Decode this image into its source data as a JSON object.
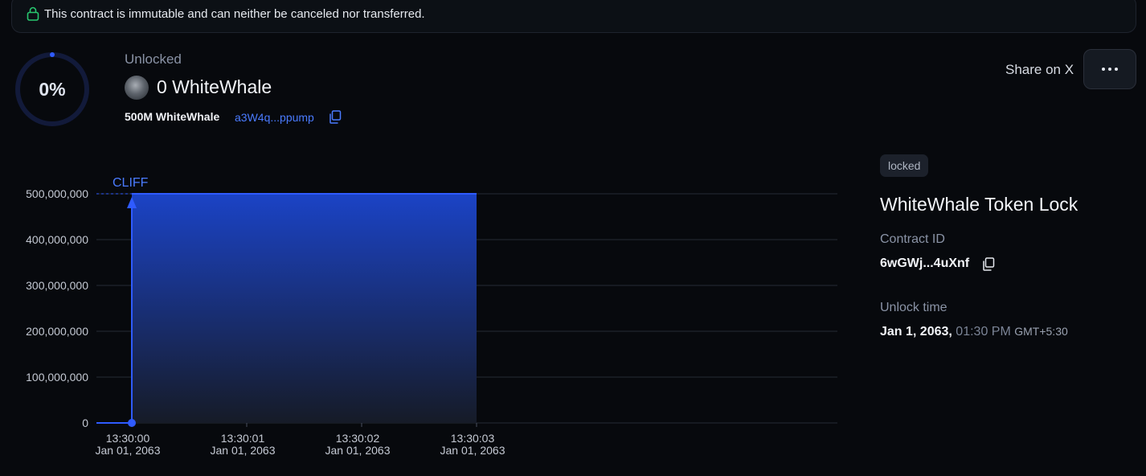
{
  "banner": {
    "icon": "lock-icon",
    "text": "This contract is immutable and can neither be canceled nor transferred."
  },
  "progress": {
    "percent_label": "0%",
    "value": 0
  },
  "header": {
    "status": "Unlocked",
    "amount": "0 WhiteWhale",
    "total": "500M WhiteWhale",
    "address": "a3W4q...ppump",
    "share_label": "Share on X",
    "menu_icon": "more-horizontal-icon"
  },
  "details": {
    "badge": "locked",
    "title": "WhiteWhale Token Lock",
    "contract_id_label": "Contract ID",
    "contract_id": "6wGWj...4uXnf",
    "unlock_time_label": "Unlock time",
    "unlock_date": "Jan 1, 2063,",
    "unlock_time": "01:30 PM",
    "unlock_tz": "GMT+5:30"
  },
  "colors": {
    "accent": "#2f5bff",
    "background": "#07090d",
    "success": "#28c76f"
  },
  "chart_data": {
    "type": "area",
    "annotation": "CLIFF",
    "y_ticks": [
      "0",
      "100,000,000",
      "200,000,000",
      "300,000,000",
      "400,000,000",
      "500,000,000"
    ],
    "y_tick_values": [
      0,
      100000000,
      200000000,
      300000000,
      400000000,
      500000000
    ],
    "ylim": [
      0,
      500000000
    ],
    "x_ticks": [
      {
        "time": "13:30:00",
        "date": "Jan 01, 2063",
        "t": 0
      },
      {
        "time": "13:30:01",
        "date": "Jan 01, 2063",
        "t": 1
      },
      {
        "time": "13:30:02",
        "date": "Jan 01, 2063",
        "t": 2
      },
      {
        "time": "13:30:03",
        "date": "Jan 01, 2063",
        "t": 3
      }
    ],
    "series": [
      {
        "points": [
          [
            0,
            0
          ],
          [
            0,
            500000000
          ],
          [
            3,
            500000000
          ]
        ]
      }
    ]
  }
}
